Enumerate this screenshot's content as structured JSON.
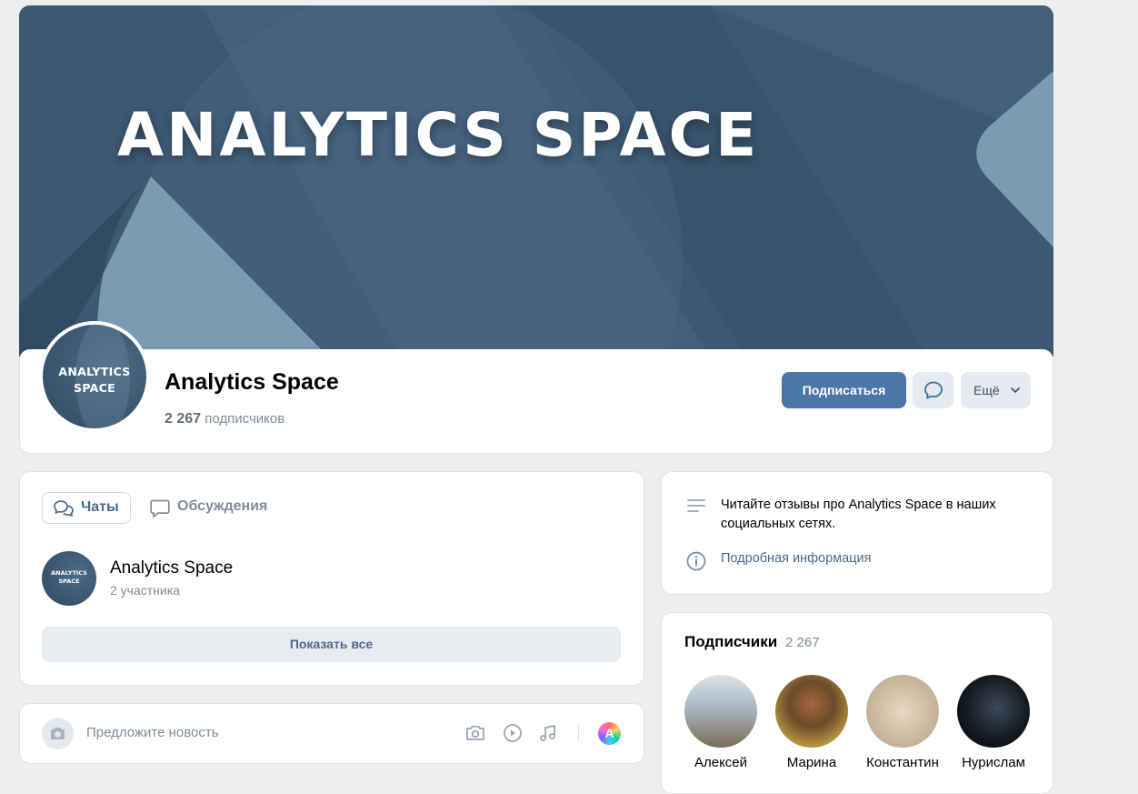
{
  "cover": {
    "title": "ANALYTICS SPACE"
  },
  "group": {
    "avatar_text_line1": "ANALYTICS",
    "avatar_text_line2": "SPACE",
    "name": "Analytics Space",
    "subscribers_count": "2 267",
    "subscribers_label": "подписчиков",
    "subscribe_label": "Подписаться",
    "more_label": "Ещё"
  },
  "chats": {
    "tabs": [
      {
        "label": "Чаты",
        "icon": "chats-icon",
        "active": true
      },
      {
        "label": "Обсуждения",
        "icon": "discussion-icon",
        "active": false
      }
    ],
    "item": {
      "avatar_text_line1": "ANALYTICS",
      "avatar_text_line2": "SPACE",
      "title": "Analytics Space",
      "subtitle": "2 участника"
    },
    "show_all_label": "Показать все"
  },
  "suggest": {
    "placeholder": "Предложите новость",
    "icons": [
      "camera-icon",
      "photo-icon",
      "video-icon",
      "music-icon",
      "ai-icon"
    ],
    "ai_letter": "A"
  },
  "info": {
    "text": "Читайте отзывы про Analytics Space в наших социальных сетях.",
    "link_label": "Подробная информация"
  },
  "subscribers": {
    "title": "Подписчики",
    "count": "2 267",
    "people": [
      {
        "name": "Алексей"
      },
      {
        "name": "Марина"
      },
      {
        "name": "Константин"
      },
      {
        "name": "Нурислам"
      }
    ]
  },
  "colors": {
    "accent": "#4a76a8",
    "cover_bg": "#3e5a74",
    "page_bg": "#edeef0"
  }
}
